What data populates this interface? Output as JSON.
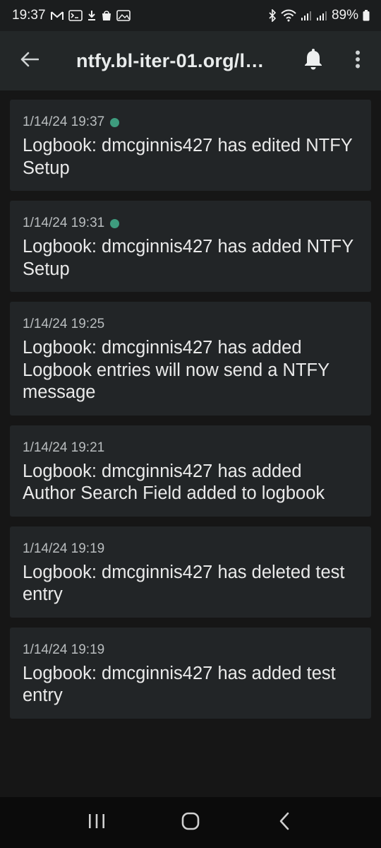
{
  "status_bar": {
    "time": "19:37",
    "battery": "89%",
    "left_icons": [
      "gmail-icon",
      "terminal-icon",
      "download-icon",
      "shopping-bag-icon",
      "image-icon"
    ],
    "right_icons": [
      "bluetooth-icon",
      "wifi-icon",
      "signal-icon",
      "signal-icon",
      "battery-icon"
    ]
  },
  "app_bar": {
    "title": "ntfy.bl-iter-01.org/l…",
    "back_icon": "arrow-left-icon",
    "bell_icon": "bell-icon",
    "menu_icon": "more-vert-icon"
  },
  "notifications": [
    {
      "time": "1/14/24 19:37",
      "unread": true,
      "message": "Logbook: dmcginnis427 has edited NTFY Setup"
    },
    {
      "time": "1/14/24 19:31",
      "unread": true,
      "message": "Logbook: dmcginnis427 has added NTFY Setup"
    },
    {
      "time": "1/14/24 19:25",
      "unread": false,
      "message": "Logbook: dmcginnis427 has added Logbook entries will now send a NTFY message"
    },
    {
      "time": "1/14/24 19:21",
      "unread": false,
      "message": "Logbook: dmcginnis427 has added Author Search Field added to logbook"
    },
    {
      "time": "1/14/24 19:19",
      "unread": false,
      "message": "Logbook: dmcginnis427 has deleted test entry"
    },
    {
      "time": "1/14/24 19:19",
      "unread": false,
      "message": "Logbook: dmcginnis427 has added test entry"
    }
  ],
  "colors": {
    "background": "#161616",
    "app_bar": "#232728",
    "card": "#222527",
    "unread_dot": "#3e9c7e"
  },
  "nav_bar": {
    "icons": [
      "recent-apps-icon",
      "home-icon",
      "back-icon"
    ]
  }
}
